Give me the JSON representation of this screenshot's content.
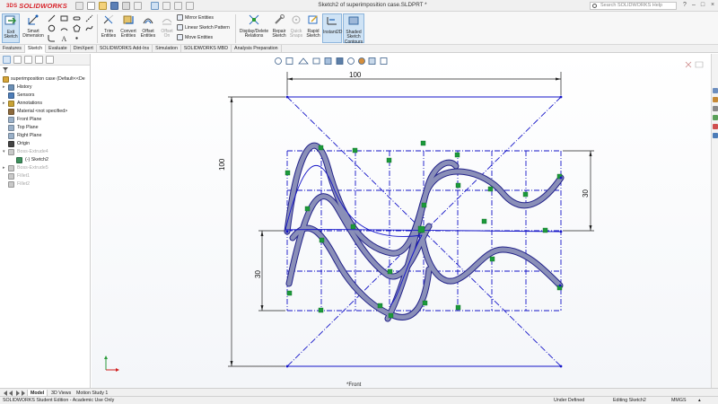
{
  "titlebar": {
    "brand": "SOLIDWORKS",
    "brand_prefix": "3DS",
    "document_title": "Sketch2 of superimposition case.SLDPRT *",
    "search_placeholder": "Search SOLIDWORKS Help",
    "window_controls": [
      "?",
      "–",
      "□",
      "×"
    ]
  },
  "ribbon": {
    "large_buttons": [
      {
        "label_1": "Exit",
        "label_2": "Sketch",
        "icon": "exit-sketch-icon",
        "active": true
      },
      {
        "label_1": "Smart",
        "label_2": "Dimension",
        "icon": "smart-dimension-icon"
      },
      {
        "label_1": "Trim",
        "label_2": "Entities",
        "icon": "trim-icon"
      },
      {
        "label_1": "Convert",
        "label_2": "Entities",
        "icon": "convert-entities-icon"
      },
      {
        "label_1": "Offset",
        "label_2": "Entities",
        "icon": "offset-entities-icon"
      },
      {
        "label_1": "Offset",
        "label_2": "On",
        "label_3": "Surface",
        "icon": "offset-surface-icon",
        "dim": true
      },
      {
        "label_1": "Display/Delete",
        "label_2": "Relations",
        "icon": "relations-icon"
      },
      {
        "label_1": "Repair",
        "label_2": "Sketch",
        "icon": "repair-icon"
      },
      {
        "label_1": "Quick",
        "label_2": "Snaps",
        "icon": "quick-snaps-icon",
        "dim": true
      },
      {
        "label_1": "Rapid",
        "label_2": "Sketch",
        "icon": "rapid-sketch-icon"
      },
      {
        "label_1": "Instant2D",
        "icon": "instant2d-icon",
        "active": true
      },
      {
        "label_1": "Shaded",
        "label_2": "Sketch",
        "label_3": "Contours",
        "icon": "shaded-contours-icon",
        "active": true
      }
    ],
    "small_buttons": [
      "Mirror Entities",
      "Linear Sketch Pattern",
      "Move Entities"
    ]
  },
  "command_tabs": [
    "Features",
    "Sketch",
    "Evaluate",
    "DimXpert",
    "SOLIDWORKS Add-Ins",
    "Simulation",
    "SOLIDWORKS MBD",
    "Analysis Preparation"
  ],
  "command_tab_selected": "Sketch",
  "tree": {
    "part": "superimposition case  (Default<<De",
    "items": [
      {
        "label": "History",
        "icon": "history-icon",
        "color": "#6b8fb5"
      },
      {
        "label": "Sensors",
        "icon": "sensor-icon",
        "color": "#4d7db8"
      },
      {
        "label": "Annotations",
        "icon": "annotations-icon",
        "color": "#c8a235"
      },
      {
        "label": "Material <not specified>",
        "icon": "material-icon",
        "color": "#8d6a3c"
      },
      {
        "label": "Front Plane",
        "icon": "plane-icon",
        "color": "#9ab0c8"
      },
      {
        "label": "Top Plane",
        "icon": "plane-icon",
        "color": "#9ab0c8"
      },
      {
        "label": "Right Plane",
        "icon": "plane-icon",
        "color": "#9ab0c8"
      },
      {
        "label": "Origin",
        "icon": "origin-icon",
        "color": "#444444"
      },
      {
        "label": "Boss-Extrude4",
        "icon": "extrude-icon",
        "color": "#c9c9c9",
        "grey": true
      },
      {
        "label": "(-) Sketch2",
        "icon": "sketch-icon",
        "color": "#3d8f5c"
      },
      {
        "label": "Boss-Extrude5",
        "icon": "extrude-icon",
        "color": "#c9c9c9",
        "grey": true
      },
      {
        "label": "Fillet1",
        "icon": "fillet-icon",
        "color": "#c9c9c9",
        "grey": true
      },
      {
        "label": "Fillet2",
        "icon": "fillet-icon",
        "color": "#c9c9c9",
        "grey": true
      }
    ]
  },
  "sketch": {
    "dimensions": {
      "top": "100",
      "left": "100",
      "right": "30",
      "lower_left": "30"
    },
    "view_label": "*Front",
    "line_color": "#1414c8",
    "curve_fill": "#8a8fb8",
    "point_color": "#1c9a3a"
  },
  "bottom_tabs": [
    "Model",
    "3D Views",
    "Motion Study 1"
  ],
  "bottom_tab_selected": "Model",
  "status": {
    "left": "SOLIDWORKS Student Edition - Academic Use Only",
    "state": "Under Defined",
    "editing": "Editing Sketch2",
    "units": "MMGS"
  }
}
